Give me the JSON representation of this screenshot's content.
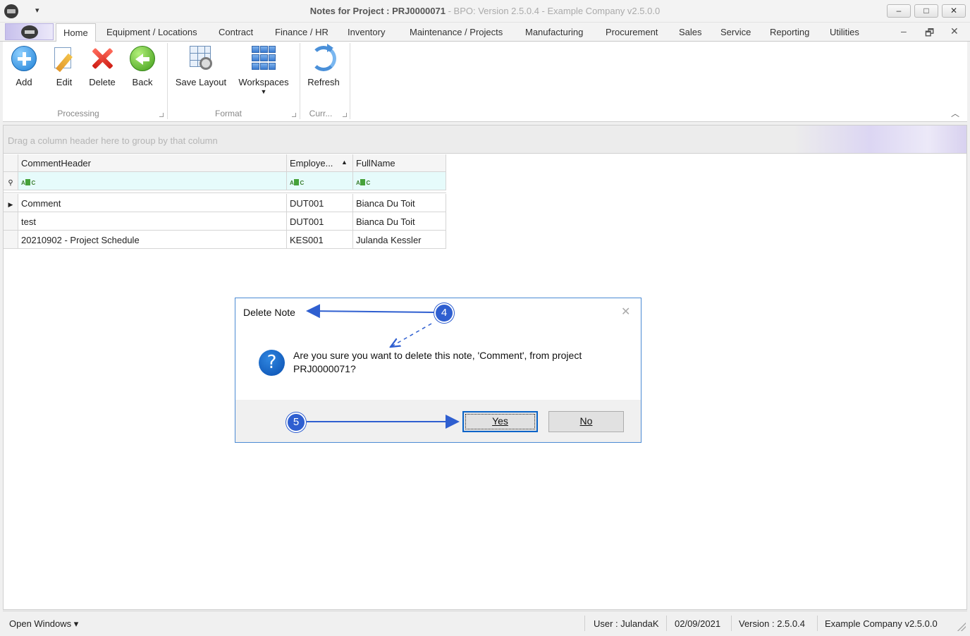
{
  "window": {
    "title_main": "Notes for Project : PRJ0000071",
    "title_sub": " - BPO: Version 2.5.0.4 - Example Company v2.5.0.0",
    "minimize": "–",
    "maximize": "□",
    "close": "✕"
  },
  "tabs": [
    {
      "label": "Home",
      "active": true
    },
    {
      "label": "Equipment / Locations"
    },
    {
      "label": "Contract"
    },
    {
      "label": "Finance / HR"
    },
    {
      "label": "Inventory"
    },
    {
      "label": "Maintenance / Projects"
    },
    {
      "label": "Manufacturing"
    },
    {
      "label": "Procurement"
    },
    {
      "label": "Sales"
    },
    {
      "label": "Service"
    },
    {
      "label": "Reporting"
    },
    {
      "label": "Utilities"
    }
  ],
  "mdi_controls": {
    "minimize": "–",
    "restore": "🗗",
    "close": "✕"
  },
  "ribbon": {
    "buttons": {
      "add": "Add",
      "edit": "Edit",
      "delete": "Delete",
      "back": "Back",
      "save_layout": "Save Layout",
      "workspaces": "Workspaces",
      "refresh": "Refresh"
    },
    "groups": {
      "processing": "Processing",
      "format": "Format",
      "currency": "Curr..."
    }
  },
  "grid": {
    "group_hint": "Drag a column header here to group by that column",
    "columns": [
      "CommentHeader",
      "Employe...",
      "FullName"
    ],
    "sort_indicator": "▲",
    "filter_icon": "ABC",
    "rows": [
      {
        "comment": "Comment",
        "employee": "DUT001",
        "fullname": "Bianca Du Toit",
        "current": true
      },
      {
        "comment": "test",
        "employee": "DUT001",
        "fullname": "Bianca Du Toit"
      },
      {
        "comment": "20210902 - Project Schedule",
        "employee": "KES001",
        "fullname": "Julanda Kessler"
      }
    ]
  },
  "dialog": {
    "title": "Delete Note",
    "message": "Are you sure you want to delete this note, 'Comment', from project PRJ0000071?",
    "yes_label": "Yes",
    "no_label": "No",
    "close": "✕",
    "icon": "?"
  },
  "annotations": {
    "step4": "4",
    "step5": "5",
    "color": "#2f5fd0"
  },
  "statusbar": {
    "open_windows": "Open Windows ▾",
    "user": "User : JulandaK",
    "date": "02/09/2021",
    "version": "Version : 2.5.0.4",
    "company": "Example Company v2.5.0.0"
  }
}
